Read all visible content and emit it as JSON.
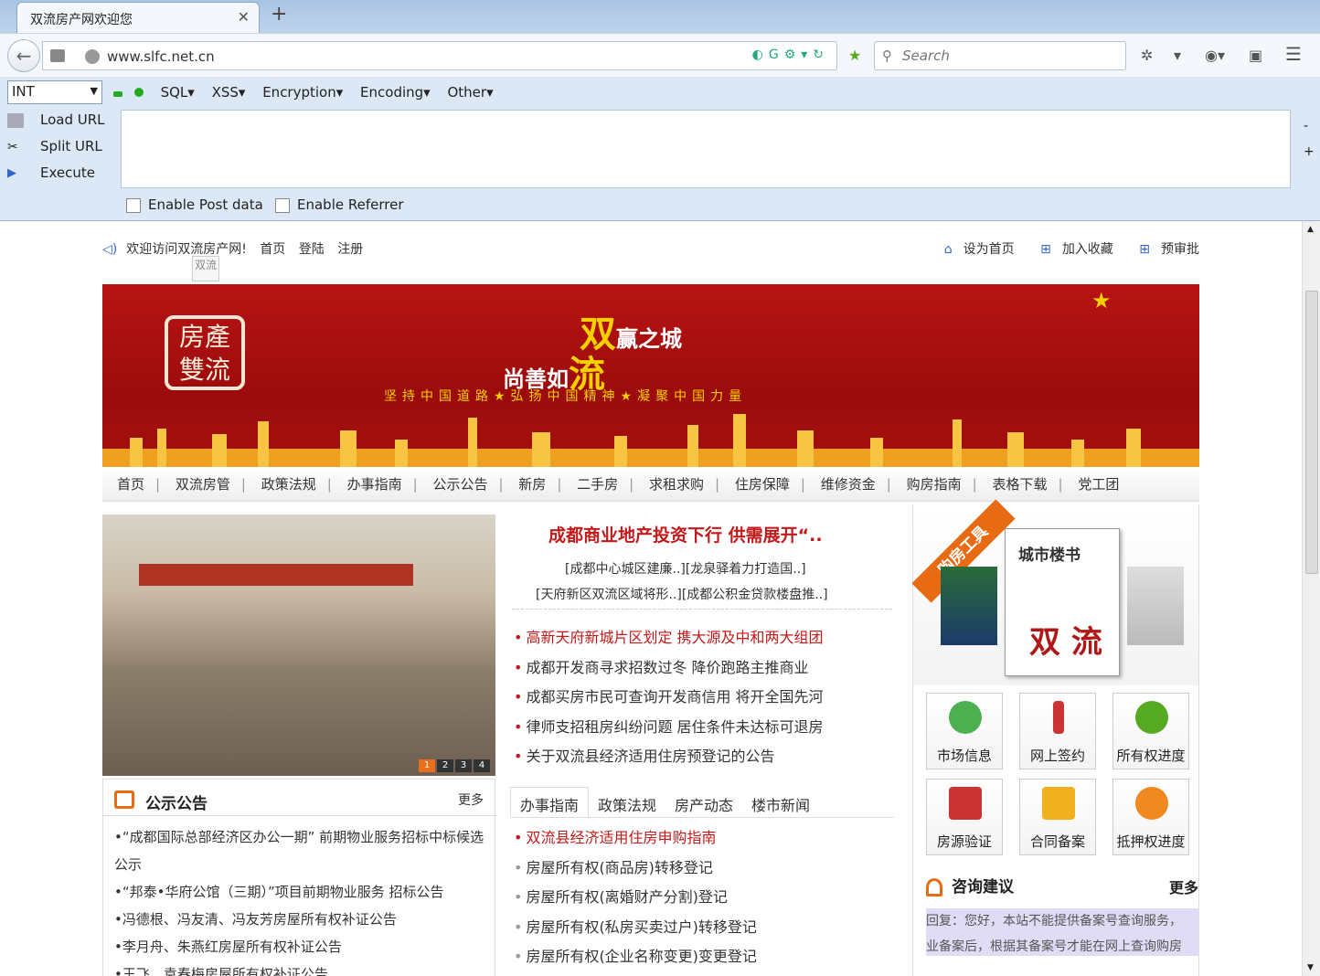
{
  "browser": {
    "tab_title": "双流房产网欢迎您",
    "url": "www.slfc.net.cn",
    "search_placeholder": "Search"
  },
  "hackbar": {
    "int_select": "INT",
    "menu": [
      "SQL▾",
      "XSS▾",
      "Encryption▾",
      "Encoding▾",
      "Other▾"
    ],
    "buttons": [
      "Load URL",
      "Split URL",
      "Execute"
    ],
    "enable_post": "Enable Post data",
    "enable_referrer": "Enable Referrer",
    "minus": "-",
    "plus": "+"
  },
  "site": {
    "welcome": "欢迎访问双流房产网!",
    "top_links": [
      "首页",
      "登陆",
      "注册"
    ],
    "right_links": [
      "设为首页",
      "加入收藏",
      "预审批"
    ],
    "broken_image_alt": "双流",
    "banner": {
      "line1_big": "双",
      "line1_small": "赢之城",
      "line2_small": "尚善如",
      "line2_big": "流",
      "slogan": "坚持中国道路★弘扬中国精神★凝聚中国力量",
      "seal": "房產雙流"
    },
    "nav": [
      "首页",
      "双流房管",
      "政策法规",
      "办事指南",
      "公示公告",
      "新房",
      "二手房",
      "求租求购",
      "住房保障",
      "维修资金",
      "购房指南",
      "表格下载",
      "党工团"
    ],
    "photo_pager": [
      "1",
      "2",
      "3",
      "4"
    ],
    "headline": "成都商业地产投资下行 供需展开“..",
    "sublinks": [
      "[成都中心城区建廉..][龙泉驿着力打造国..]",
      "[天府新区双流区域将形..][成都公积金贷款楼盘推..]"
    ],
    "news": [
      "高新天府新城片区划定 携大源及中和两大组团",
      "成都开发商寻求招数过冬 降价跑路主推商业",
      "成都买房市民可查询开发商信用 将开全国先河",
      "律师支招租房纠纷问题 居住条件未达标可退房",
      "关于双流县经济适用住房预登记的公告"
    ],
    "notice": {
      "title": "公示公告",
      "more": "更多",
      "items": [
        "•“成都国际总部经济区办公一期” 前期物业服务招标中标候选",
        "公示",
        "•“邦泰•华府公馆（三期）”项目前期物业服务 招标公告",
        "•冯德根、冯友清、冯友芳房屋所有权补证公告",
        "•李月舟、朱燕红房屋所有权补证公告",
        "•王飞、袁春梅房屋所有权补证公告"
      ]
    },
    "guide_tabs": [
      "办事指南",
      "政策法规",
      "房产动态",
      "楼市新闻"
    ],
    "guide": [
      "双流县经济适用住房申购指南",
      "房屋所有权(商品房)转移登记",
      "房屋所有权(离婚财产分割)登记",
      "房屋所有权(私房买卖过户)转移登记",
      "房屋所有权(企业名称变更)变更登记"
    ],
    "tools_ribbon": "购房工具",
    "book_title": "城市楼书",
    "book_big": "双 流",
    "tools": [
      "市场信息",
      "网上签约",
      "所有权进度",
      "房源验证",
      "合同备案",
      "抵押权进度"
    ],
    "advice": {
      "title": "咨询建议",
      "more": "更多",
      "reply1": "回复：您好，本站不能提供备案号查询服务，",
      "reply2": "业备案后，根据其备案号才能在网上查询购房"
    }
  },
  "colors": {
    "accent_red": "#c21a1a",
    "orange": "#e86a12",
    "banner_red": "#b81414"
  }
}
